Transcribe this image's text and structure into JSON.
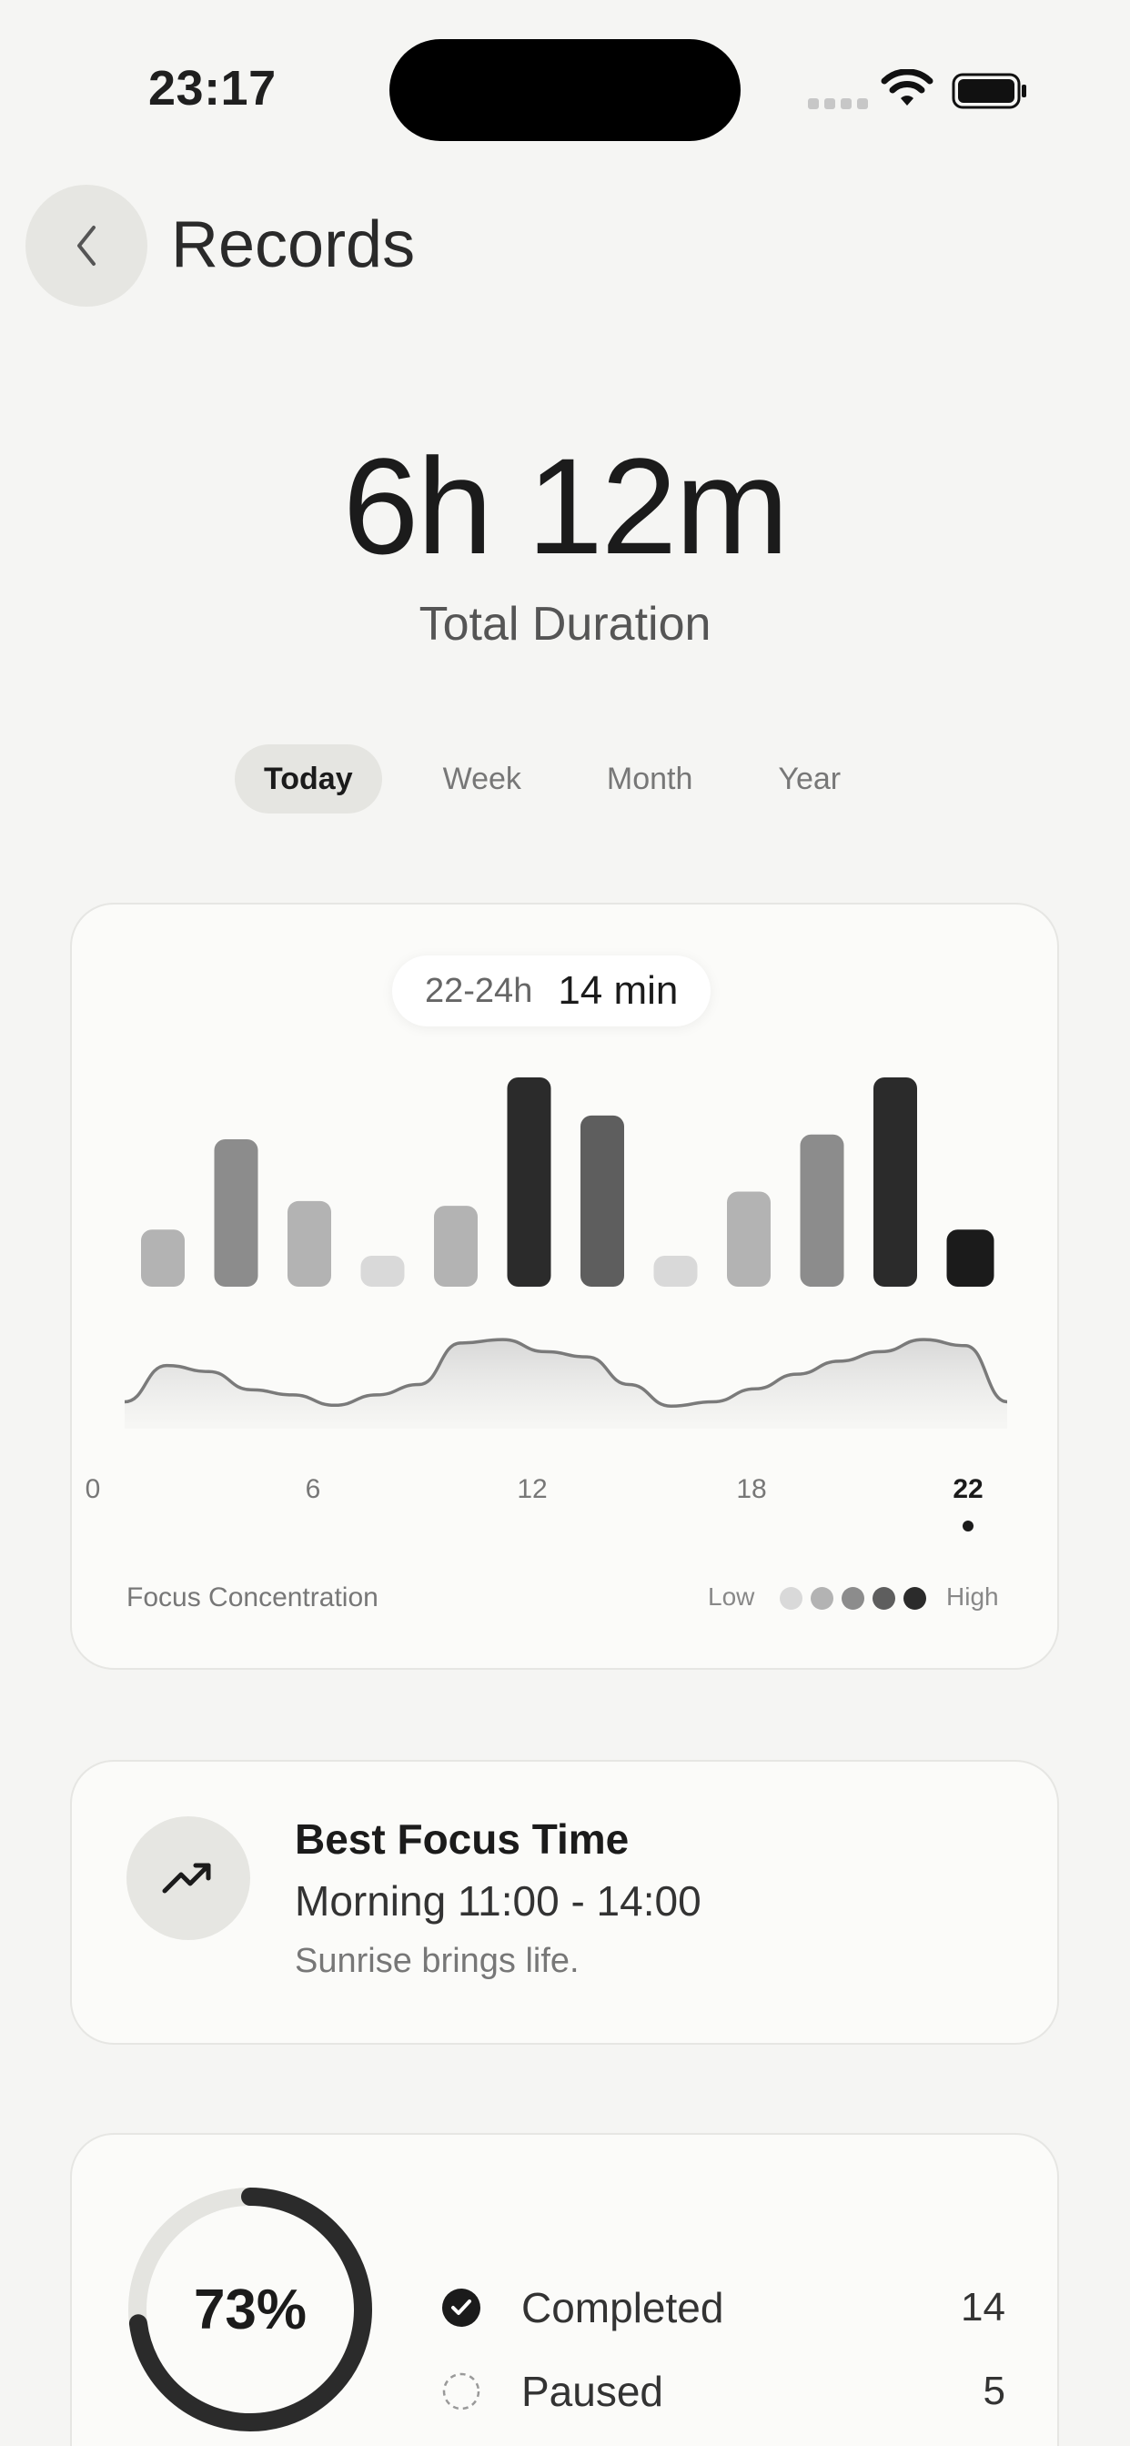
{
  "status_bar": {
    "time": "23:17"
  },
  "header": {
    "title": "Records"
  },
  "summary": {
    "total": "6h 12m",
    "label": "Total Duration"
  },
  "tabs": [
    {
      "label": "Today",
      "active": true
    },
    {
      "label": "Week",
      "active": false
    },
    {
      "label": "Month",
      "active": false
    },
    {
      "label": "Year",
      "active": false
    }
  ],
  "chart_card": {
    "tooltip": {
      "range": "22-24h",
      "value": "14 min"
    },
    "legend": {
      "title": "Focus Concentration",
      "low": "Low",
      "high": "High",
      "scale_colors": [
        "#d9d9d9",
        "#b3b3b3",
        "#8c8c8c",
        "#5e5e5e",
        "#2b2b2b"
      ]
    }
  },
  "chart_data": {
    "type": "bar",
    "x_ticks": [
      "0",
      "6",
      "12",
      "18",
      "22"
    ],
    "selected_tick": "22",
    "bars": [
      {
        "level": 2
      },
      {
        "level": 3
      },
      {
        "level": 2
      },
      {
        "level": 1
      },
      {
        "level": 2
      },
      {
        "level": 5
      },
      {
        "level": 4
      },
      {
        "level": 1
      },
      {
        "level": 2
      },
      {
        "level": 3
      },
      {
        "level": 5
      },
      {
        "level": 5,
        "selected": true
      }
    ],
    "bar_values": [
      12,
      31,
      18,
      6,
      17,
      44,
      36,
      6,
      20,
      32,
      44,
      12
    ],
    "trend_line": [
      0.1,
      0.52,
      0.45,
      0.24,
      0.18,
      0.06,
      0.18,
      0.3,
      0.78,
      0.82,
      0.68,
      0.62,
      0.3,
      0.05,
      0.1,
      0.25,
      0.42,
      0.57,
      0.68,
      0.82,
      0.75,
      0.1
    ]
  },
  "best_focus": {
    "title": "Best Focus Time",
    "time": "Morning 11:00 - 14:00",
    "quote": "Sunrise brings life."
  },
  "completion": {
    "percent_label": "73%",
    "percent": 0.73,
    "rows": [
      {
        "label": "Completed",
        "count": "14"
      },
      {
        "label": "Paused",
        "count": "5"
      }
    ]
  }
}
